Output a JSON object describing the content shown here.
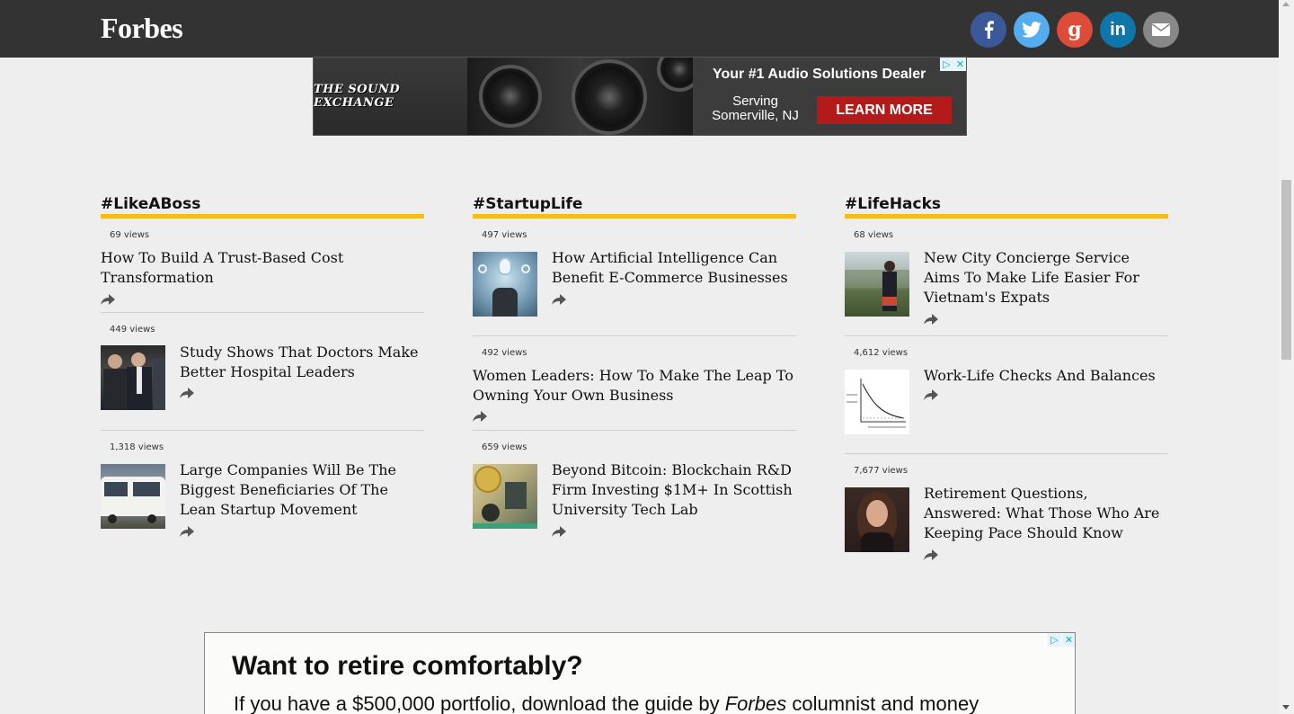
{
  "header": {
    "logo": "Forbes",
    "social": [
      "facebook-icon",
      "twitter-icon",
      "google-plus-icon",
      "linkedin-icon",
      "email-icon"
    ],
    "google_glyph": "g",
    "linkedin_glyph": "in"
  },
  "top_ad": {
    "logo_text": "THE SOUND EXCHANGE",
    "headline": "Your #1 Audio Solutions Dealer",
    "sub": "Serving Somerville, NJ",
    "cta": "LEARN MORE"
  },
  "columns": [
    {
      "title": "#LikeABoss",
      "stories": [
        {
          "views": "69 views",
          "headline": "How To Build A Trust-Based Cost Transformation"
        },
        {
          "views": "449 views",
          "headline": "Study Shows That Doctors Make Better Hospital Leaders"
        },
        {
          "views": "1,318 views",
          "headline": "Large Companies Will Be The Biggest Beneficiaries Of The Lean Startup Movement"
        }
      ]
    },
    {
      "title": "#StartupLife",
      "stories": [
        {
          "views": "497 views",
          "headline": "How Artificial Intelligence Can Benefit E-Commerce Businesses"
        },
        {
          "views": "492 views",
          "headline": "Women Leaders: How To Make The Leap To Owning Your Own Business"
        },
        {
          "views": "659 views",
          "headline": "Beyond Bitcoin: Blockchain R&D Firm Investing $1M+ In Scottish University Tech Lab"
        }
      ]
    },
    {
      "title": "#LifeHacks",
      "stories": [
        {
          "views": "68 views",
          "headline": "New City Concierge Service Aims To Make Life Easier For Vietnam's Expats"
        },
        {
          "views": "4,612 views",
          "headline": "Work-Life Checks And Balances"
        },
        {
          "views": "7,677 views",
          "headline": "Retirement Questions, Answered: What Those Who Are Keeping Pace Should Know"
        }
      ]
    }
  ],
  "bottom_ad": {
    "title": "Want to retire comfortably?",
    "body_pre": "If you have a $500,000 portfolio, download the guide by ",
    "body_em": "Forbes",
    "body_post": " columnist and money"
  },
  "colors": {
    "accent": "#f6bc1b",
    "header_bg": "#333333",
    "facebook": "#3b5998",
    "twitter": "#55acee",
    "google": "#dd4b39",
    "linkedin": "#0e76a8"
  }
}
